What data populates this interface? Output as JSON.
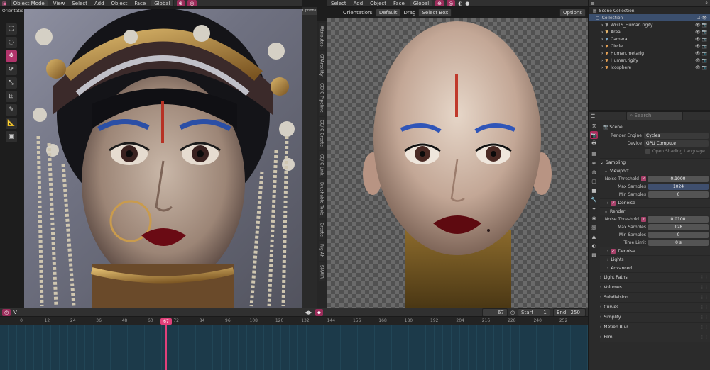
{
  "left_viewport": {
    "header": {
      "mode": "Object Mode",
      "menus": [
        "View",
        "Select",
        "Add",
        "Object",
        "Face"
      ],
      "transform": "Global",
      "options": "Options"
    },
    "orientation_label": "Orientatio",
    "side_tabs": [
      "Attributes",
      "GRAreality",
      "CC/iC Pipeline",
      "CC/iC Create",
      "CC/iC Link",
      "Brushable Tools",
      "Create",
      "Rig-Ah",
      "SMAIR"
    ],
    "bottom_label": "V"
  },
  "right_viewport": {
    "header": {
      "menus": [
        "Select",
        "Add",
        "Object",
        "Face"
      ],
      "transform": "Global"
    },
    "subheader": {
      "orientation_label": "Orientation:",
      "orientation_value": "Default",
      "drag_label": "Drag",
      "drag_value": "Select Box",
      "options": "Options"
    }
  },
  "playback": {
    "current_frame": "67",
    "start_label": "Start",
    "start_value": "1",
    "end_label": "End",
    "end_value": "250"
  },
  "timeline": {
    "ticks": [
      "0",
      "12",
      "24",
      "36",
      "48",
      "60",
      "67",
      "72",
      "84",
      "96",
      "108",
      "120",
      "132",
      "144",
      "156",
      "168",
      "180",
      "192",
      "204",
      "216",
      "228",
      "240",
      "252"
    ],
    "current": "67"
  },
  "outliner": {
    "root": "Scene Collection",
    "collection": "Collection",
    "items": [
      {
        "name": "WGTS_Human.rigify",
        "color": "#9a9a9a"
      },
      {
        "name": "Area",
        "color": "#e8b86d"
      },
      {
        "name": "Camera",
        "color": "#7aa7c7"
      },
      {
        "name": "Circle",
        "color": "#e8a254"
      },
      {
        "name": "Human.metarig",
        "color": "#e8a254"
      },
      {
        "name": "Human.rigify",
        "color": "#e8a254"
      },
      {
        "name": "Icosphere",
        "color": "#e8a254"
      }
    ]
  },
  "properties": {
    "search_placeholder": "Search",
    "scene_label": "Scene",
    "render_engine_label": "Render Engine",
    "render_engine_value": "Cycles",
    "device_label": "Device",
    "device_value": "GPU Compute",
    "osl_label": "Open Shading Language",
    "sampling": "Sampling",
    "viewport": "Viewport",
    "vp_noise_label": "Noise Threshold",
    "vp_noise_value": "0.1000",
    "vp_max_label": "Max Samples",
    "vp_max_value": "1024",
    "vp_min_label": "Min Samples",
    "vp_min_value": "0",
    "vp_denoise": "Denoise",
    "render": "Render",
    "r_noise_label": "Noise Threshold",
    "r_noise_value": "0.0100",
    "r_max_label": "Max Samples",
    "r_max_value": "128",
    "r_min_label": "Min Samples",
    "r_min_value": "0",
    "r_time_label": "Time Limit",
    "r_time_value": "0 s",
    "r_denoise": "Denoise",
    "lights": "Lights",
    "advanced": "Advanced",
    "sections": [
      "Light Paths",
      "Volumes",
      "Subdivision",
      "Curves",
      "Simplify",
      "Motion Blur",
      "Film"
    ]
  },
  "colors": {
    "accent": "#b1346b",
    "playhead": "#e0407a",
    "timeline_bg": "#1c3a4a"
  }
}
